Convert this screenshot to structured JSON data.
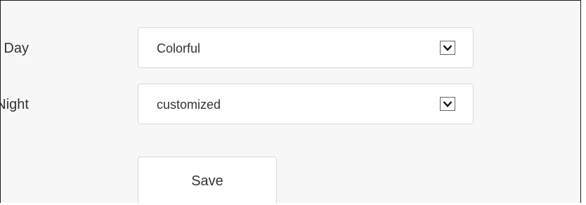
{
  "form": {
    "day": {
      "label": "Day",
      "selected": "Colorful",
      "icon": "chevron-down-icon"
    },
    "night": {
      "label": "Night",
      "selected": "customized",
      "icon": "chevron-down-icon"
    },
    "save_label": "Save"
  }
}
